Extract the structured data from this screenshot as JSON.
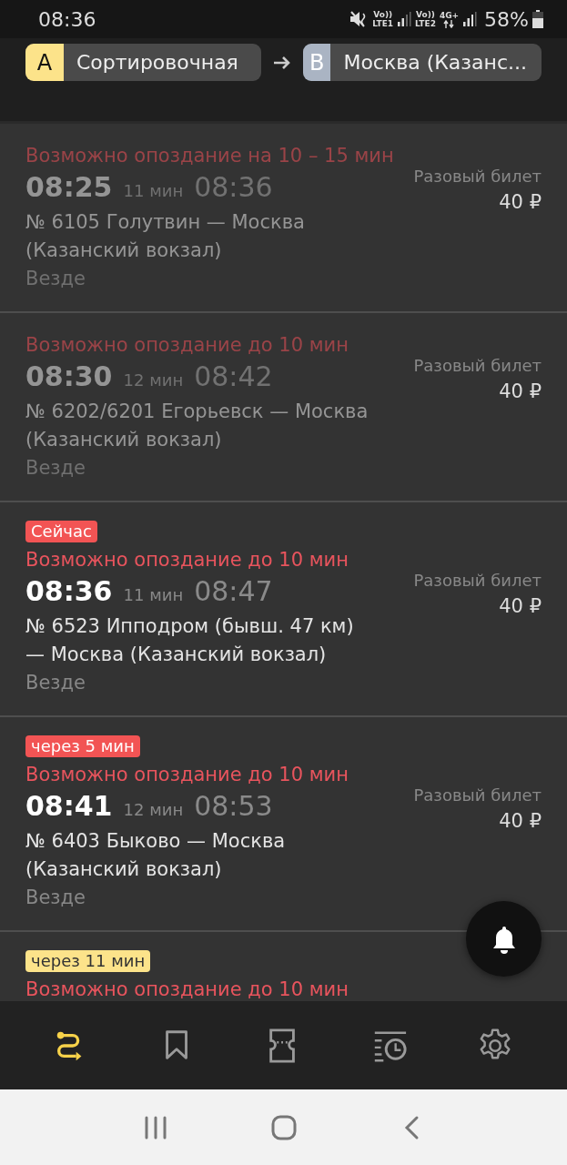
{
  "status_bar": {
    "time": "08:36",
    "sim1": {
      "volte": "Vo))",
      "network": "LTE1"
    },
    "sim2": {
      "volte": "Vo))",
      "network": "LTE2",
      "data": "4G+"
    },
    "battery": "58%"
  },
  "route": {
    "from": {
      "letter": "A",
      "name": "Сортировочная",
      "color": "#fce38a"
    },
    "to": {
      "letter": "B",
      "name": "Москва (Казанс...",
      "color": "#aab4c3"
    }
  },
  "trains": [
    {
      "past": true,
      "delay": "Возможно опоздание на 10 – 15 мин",
      "depart": "08:25",
      "duration": "11 мин",
      "arrive": "08:36",
      "title": "№ 6105 Голутвин — Москва (Казанский вокзал)",
      "days": "Везде",
      "fare": "Разовый билет",
      "price": "40 ₽"
    },
    {
      "past": true,
      "delay": "Возможно опоздание до 10 мин",
      "depart": "08:30",
      "duration": "12 мин",
      "arrive": "08:42",
      "title": "№ 6202/6201 Егорьевск — Москва (Казанский вокзал)",
      "days": "Везде",
      "fare": "Разовый билет",
      "price": "40 ₽"
    },
    {
      "past": false,
      "badge": {
        "text": "Сейчас",
        "color": "#f25454"
      },
      "delay": "Возможно опоздание до 10 мин",
      "depart": "08:36",
      "duration": "11 мин",
      "arrive": "08:47",
      "title": "№ 6523 Ипподром (бывш. 47 км) — Москва (Казанский вокзал)",
      "days": "Везде",
      "fare": "Разовый билет",
      "price": "40 ₽"
    },
    {
      "past": false,
      "badge": {
        "text": "через 5 мин",
        "color": "#f25454"
      },
      "delay": "Возможно опоздание до 10 мин",
      "depart": "08:41",
      "duration": "12 мин",
      "arrive": "08:53",
      "title": "№ 6403 Быково — Москва (Казанский вокзал)",
      "days": "Везде",
      "fare": "Разовый билет",
      "price": "40 ₽"
    },
    {
      "past": false,
      "badge": {
        "text": "через 11 мин",
        "color": "#fce38a"
      },
      "delay": "Возможно опоздание до 10 мин"
    }
  ],
  "tab_bar": [
    {
      "kind": "route",
      "selected": true
    },
    {
      "kind": "bookmark",
      "selected": false
    },
    {
      "kind": "ticket",
      "selected": false
    },
    {
      "kind": "history",
      "selected": false
    },
    {
      "kind": "settings",
      "selected": false
    }
  ]
}
